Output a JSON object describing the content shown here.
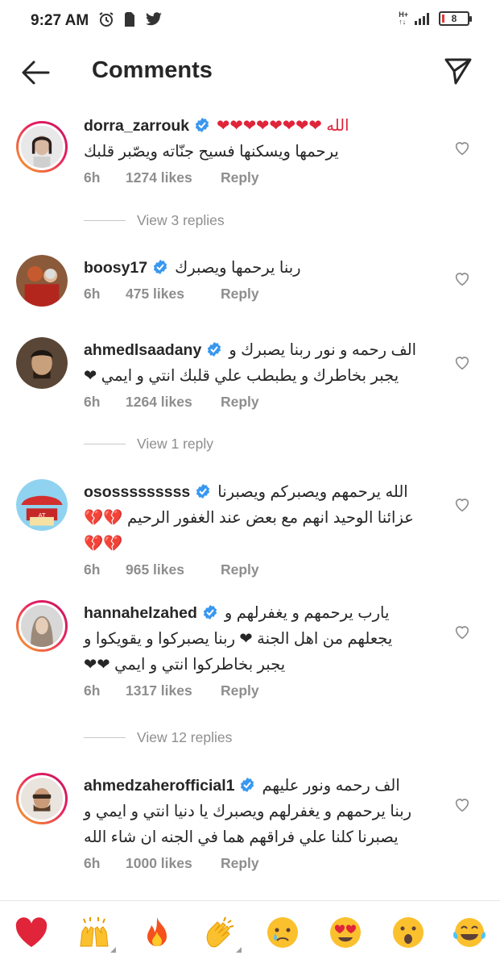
{
  "status": {
    "time": "9:27 AM",
    "network": "H+",
    "battery": "8"
  },
  "header": {
    "title": "Comments"
  },
  "comments": [
    {
      "username": "dorra_zarrouk",
      "lines": [
        "الله ❤❤❤❤❤❤❤❤",
        "يرحمها ويسكنها فسيح جنّاته ويصّبر قلبك"
      ],
      "time": "6h",
      "likes": "1274 likes",
      "reply": "Reply",
      "view_replies": "View 3 replies"
    },
    {
      "username": "boosy17",
      "lines": [
        "ربنا يرحمها ويصبرك"
      ],
      "time": "6h",
      "likes": "475 likes",
      "reply": "Reply"
    },
    {
      "username": "ahmedlsaadany",
      "lines": [
        "الف رحمه و نور ربنا يصبرك و",
        "يجبر بخاطرك و يطبطب علي قلبك انتي و ايمي ❤"
      ],
      "time": "6h",
      "likes": "1264 likes",
      "reply": "Reply",
      "view_replies": "View 1 reply"
    },
    {
      "username": "ososssssssss",
      "lines": [
        "الله يرحمهم ويصبركم ويصبرنا",
        "عزائنا الوحيد انهم مع بعض عند الغفور الرحيم 💔💔",
        "💔💔"
      ],
      "time": "6h",
      "likes": "965 likes",
      "reply": "Reply"
    },
    {
      "username": "hannahelzahed",
      "lines": [
        "يارب يرحمهم و يغفرلهم و",
        "يجعلهم من اهل الجنة ❤ ربنا يصبركوا و يقويكوا و",
        "يجبر بخاطركوا انتي و ايمي ❤❤"
      ],
      "time": "6h",
      "likes": "1317 likes",
      "reply": "Reply",
      "view_replies": "View 12 replies"
    },
    {
      "username": "ahmedzaherofficial1",
      "lines": [
        "الف رحمه ونور عليهم",
        "ربنا يرحمهم و يغفرلهم ويصبرك يا دنيا انتي و ايمي و",
        "يصبرنا كلنا علي فراقهم هما في الجنه ان شاء الله"
      ],
      "time": "6h",
      "likes": "1000 likes",
      "reply": "Reply"
    }
  ],
  "emoji_bar": [
    "heart",
    "raising-hands",
    "fire",
    "clapping-hands",
    "crying-face",
    "heart-eyes-face",
    "surprised-face",
    "tears-of-joy-face"
  ],
  "colors": {
    "heart": "#e0243a",
    "verified": "#3897f0",
    "muted": "#8e8e8e"
  }
}
